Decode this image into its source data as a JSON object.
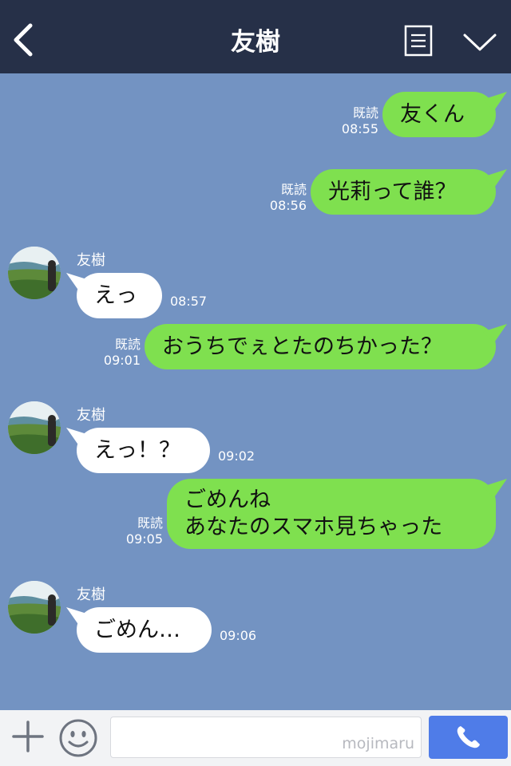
{
  "header": {
    "title": "友樹",
    "bg_color": "#263048",
    "icons": [
      "chevron-left-icon",
      "notes-icon",
      "chevron-down-icon"
    ]
  },
  "colors": {
    "chat_bg": "#7393c2",
    "outgoing_bubble": "#7fe04f",
    "incoming_bubble": "#ffffff",
    "call_button": "#4f7ce8"
  },
  "messages": [
    {
      "dir": "out",
      "text": "友くん",
      "read": "既読",
      "time": "08:55"
    },
    {
      "dir": "out",
      "text": "光莉って誰？",
      "read": "既読",
      "time": "08:56"
    },
    {
      "dir": "in",
      "sender": "友樹",
      "text": "えっ",
      "time": "08:57"
    },
    {
      "dir": "out",
      "text": "おうちでぇとたのちかった？",
      "read": "既読",
      "time": "09:01"
    },
    {
      "dir": "in",
      "sender": "友樹",
      "text": "えっ！？",
      "time": "09:02"
    },
    {
      "dir": "out",
      "text": "ごめんね\nあなたのスマホ見ちゃった",
      "read": "既読",
      "time": "09:05"
    },
    {
      "dir": "in",
      "sender": "友樹",
      "text": "ごめん…",
      "time": "09:06"
    }
  ],
  "input": {
    "value": "",
    "watermark": "mojimaru",
    "icons": [
      "plus-icon",
      "smiley-icon",
      "phone-icon"
    ]
  }
}
